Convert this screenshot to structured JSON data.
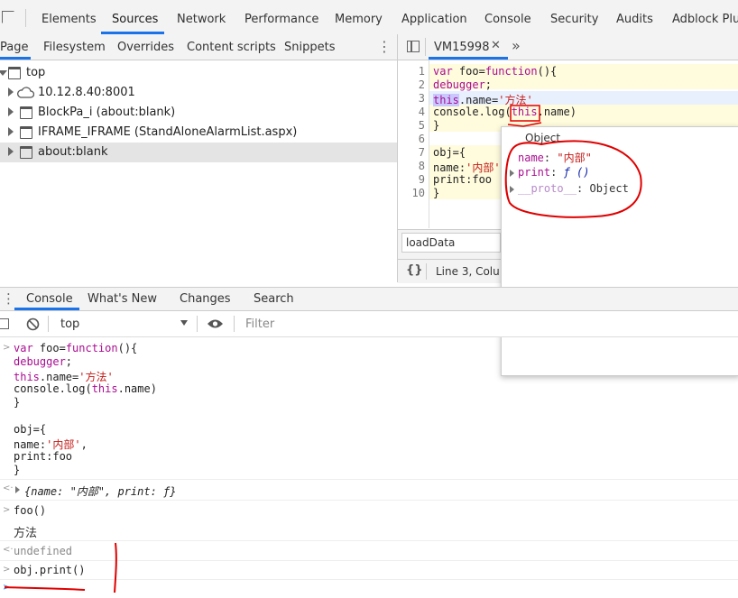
{
  "top_tabs": [
    "Elements",
    "Sources",
    "Network",
    "Performance",
    "Memory",
    "Application",
    "Console",
    "Security",
    "Audits",
    "Adblock Plus"
  ],
  "nav_tabs": [
    "Page",
    "Filesystem",
    "Overrides",
    "Content scripts",
    "Snippets"
  ],
  "tree": [
    "top",
    "10.12.8.40:8001",
    "BlockPa_i (about:blank)",
    "IFRAME_IFRAME (StandAloneAlarmList.aspx)",
    "about:blank"
  ],
  "editor": {
    "file_tab": "VM15998",
    "line_numbers": [
      "1",
      "2",
      "3",
      "4",
      "5",
      "6",
      "7",
      "8",
      "9",
      "10"
    ],
    "search_value": "loadData",
    "status": "Line 3, Colu"
  },
  "popover": {
    "title": "Object",
    "name_key": "name",
    "name_value": "\"内部\"",
    "print_key": "print",
    "print_value": "ƒ ()",
    "proto_key": "__proto__",
    "proto_value": "Object"
  },
  "drawer_tabs": [
    "Console",
    "What's New",
    "Changes",
    "Search"
  ],
  "console_toolbar": {
    "context": "top",
    "filter_placeholder": "Filter"
  },
  "console": {
    "obj_summary": "{name: \"内部\", print: ƒ}",
    "call1": "foo()",
    "out1": "方法",
    "result": "undefined",
    "call2": "obj.print()"
  },
  "colors": {
    "accent": "#1a73e8",
    "annotation": "#e00000"
  }
}
